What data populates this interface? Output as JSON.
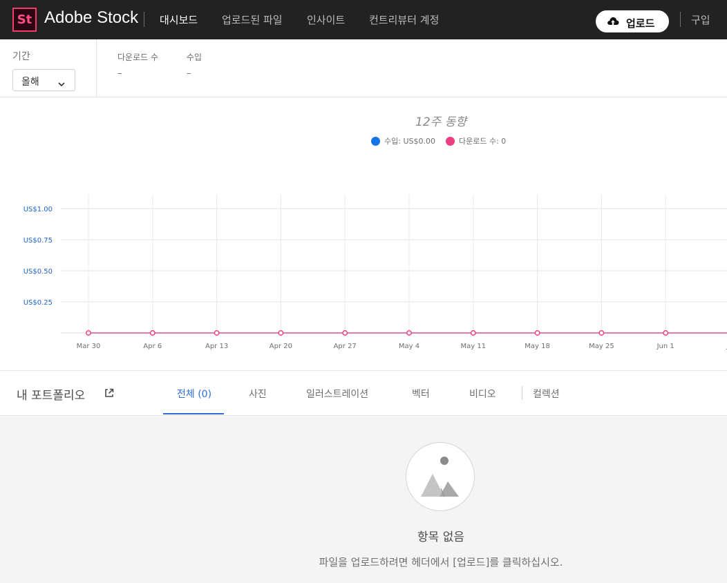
{
  "header": {
    "logo_text": "St",
    "brand": "Adobe Stock",
    "nav": [
      "대시보드",
      "업로드된 파일",
      "인사이트",
      "컨트리뷰터 계정"
    ],
    "active_nav": "대시보드",
    "upload_label": "업로드",
    "buy_label": "구입"
  },
  "stats": {
    "period_label": "기간",
    "period_value": "올해",
    "downloads_label": "다운로드 수",
    "downloads_value": "–",
    "revenue_label": "수입",
    "revenue_value": "–"
  },
  "chart_data": {
    "type": "line",
    "title": "12주 동향",
    "categories": [
      "Mar 30",
      "Apr 6",
      "Apr 13",
      "Apr 20",
      "Apr 27",
      "May 4",
      "May 11",
      "May 18",
      "May 25",
      "Jun 1",
      "Ju"
    ],
    "y_tick_labels": [
      "US$1.00",
      "US$0.75",
      "US$0.50",
      "US$0.25"
    ],
    "ylim": [
      0,
      1.0
    ],
    "grid": true,
    "legend_position": "top-center",
    "series": [
      {
        "name": "수입",
        "legend_text": "수입: US$0.00",
        "color": "#1473e6",
        "values": [
          0,
          0,
          0,
          0,
          0,
          0,
          0,
          0,
          0,
          0,
          0
        ]
      },
      {
        "name": "다운로드 수",
        "legend_text": "다운로드 수: 0",
        "color": "#ee3f82",
        "values": [
          0,
          0,
          0,
          0,
          0,
          0,
          0,
          0,
          0,
          0,
          0
        ]
      }
    ]
  },
  "portfolio": {
    "title": "내 포트폴리오",
    "tabs": [
      "전체 (0)",
      "사진",
      "일러스트레이션",
      "벡터",
      "비디오",
      "컬렉션"
    ],
    "active_tab": "전체 (0)"
  },
  "empty_state": {
    "title": "항목 없음",
    "description": "파일을 업로드하려면 헤더에서 [업로드]를 클릭하십시오."
  },
  "colors": {
    "header_bg": "#222222",
    "accent_blue": "#2d6fd6",
    "revenue_blue": "#1473e6",
    "downloads_pink": "#ee3f82",
    "logo_pink": "#ee3f6b"
  }
}
